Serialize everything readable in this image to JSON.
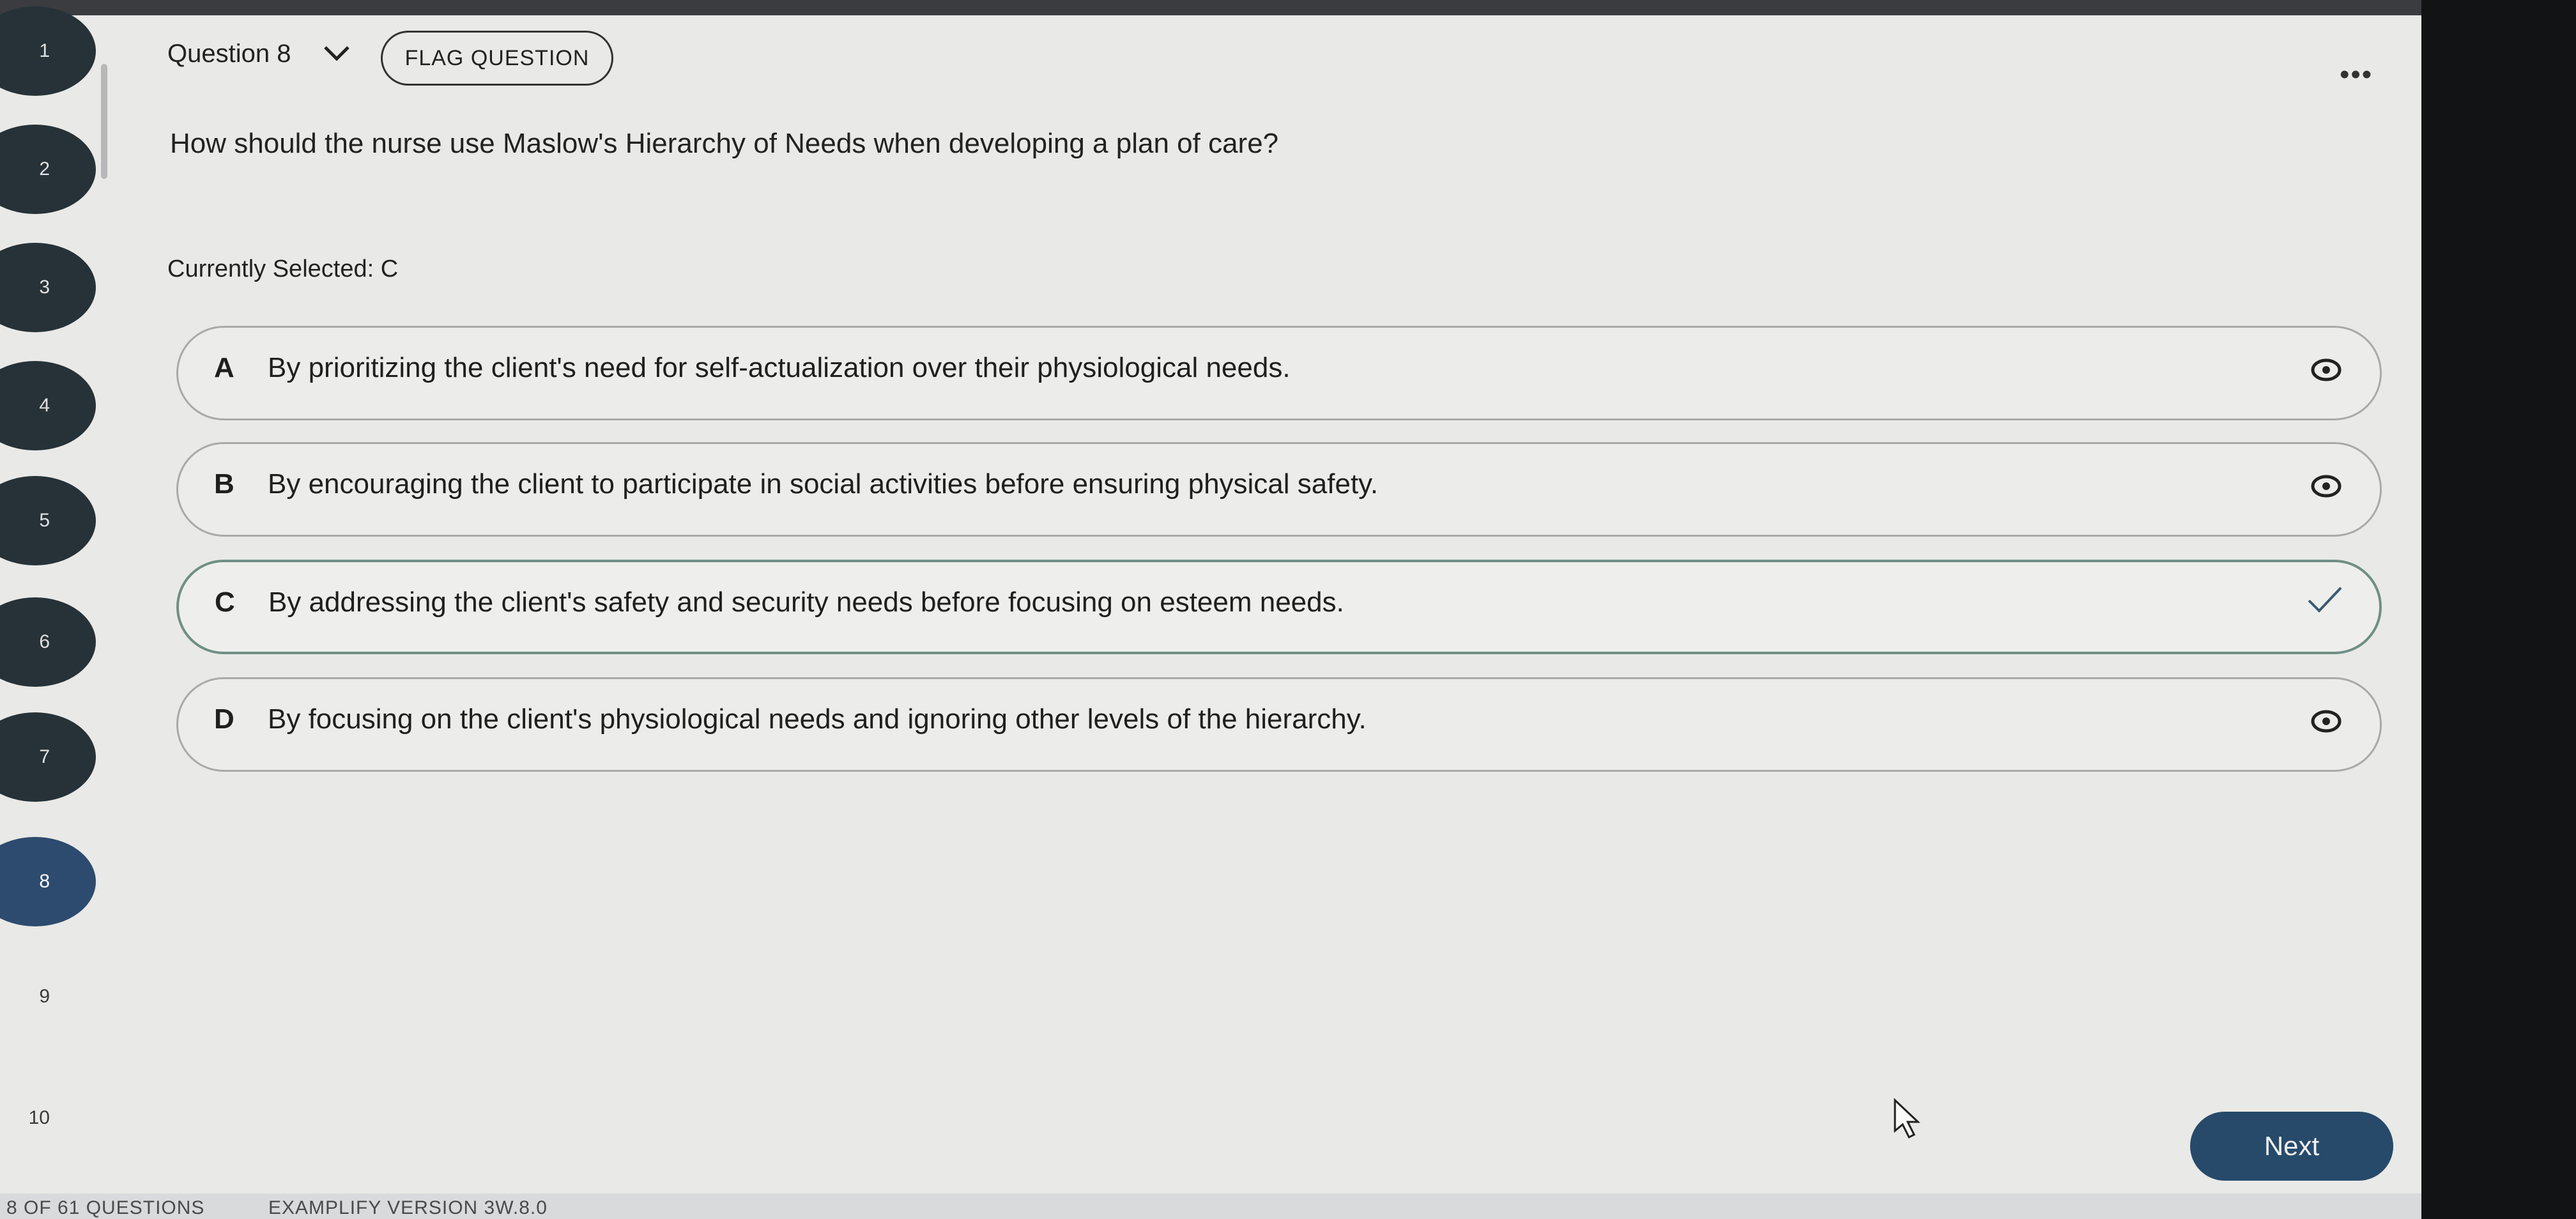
{
  "nav": {
    "items": [
      {
        "label": "1"
      },
      {
        "label": "2"
      },
      {
        "label": "3"
      },
      {
        "label": "4"
      },
      {
        "label": "5"
      },
      {
        "label": "6"
      },
      {
        "label": "7"
      },
      {
        "label": "8"
      },
      {
        "label": "9"
      },
      {
        "label": "10"
      }
    ],
    "current": "8"
  },
  "header": {
    "question_label": "Question 8",
    "flag_label": "FLAG QUESTION",
    "more_label": "•••"
  },
  "question": {
    "text": "How should the nurse use Maslow's Hierarchy of Needs when developing a plan of care?",
    "selected_text": "Currently Selected: C"
  },
  "options": [
    {
      "letter": "A",
      "text": "By prioritizing the client's need for self-actualization over their physiological needs.",
      "icon": "eye-icon"
    },
    {
      "letter": "B",
      "text": "By encouraging the client to participate in social activities before ensuring physical safety.",
      "icon": "eye-icon"
    },
    {
      "letter": "C",
      "text": "By addressing the client's safety and security needs before focusing on esteem needs.",
      "icon": "check-icon"
    },
    {
      "letter": "D",
      "text": "By focusing on the client's physiological needs and ignoring other levels of the hierarchy.",
      "icon": "eye-icon"
    }
  ],
  "footer": {
    "count_text": "8 OF 61 QUESTIONS",
    "version_text": "EXAMPLIFY VERSION 3W.8.0"
  },
  "next_label": "Next",
  "colors": {
    "accent": "#274a6a",
    "nav_dark": "#263238",
    "selected_border": "#6f8f86",
    "background": "#e9e9e7"
  }
}
